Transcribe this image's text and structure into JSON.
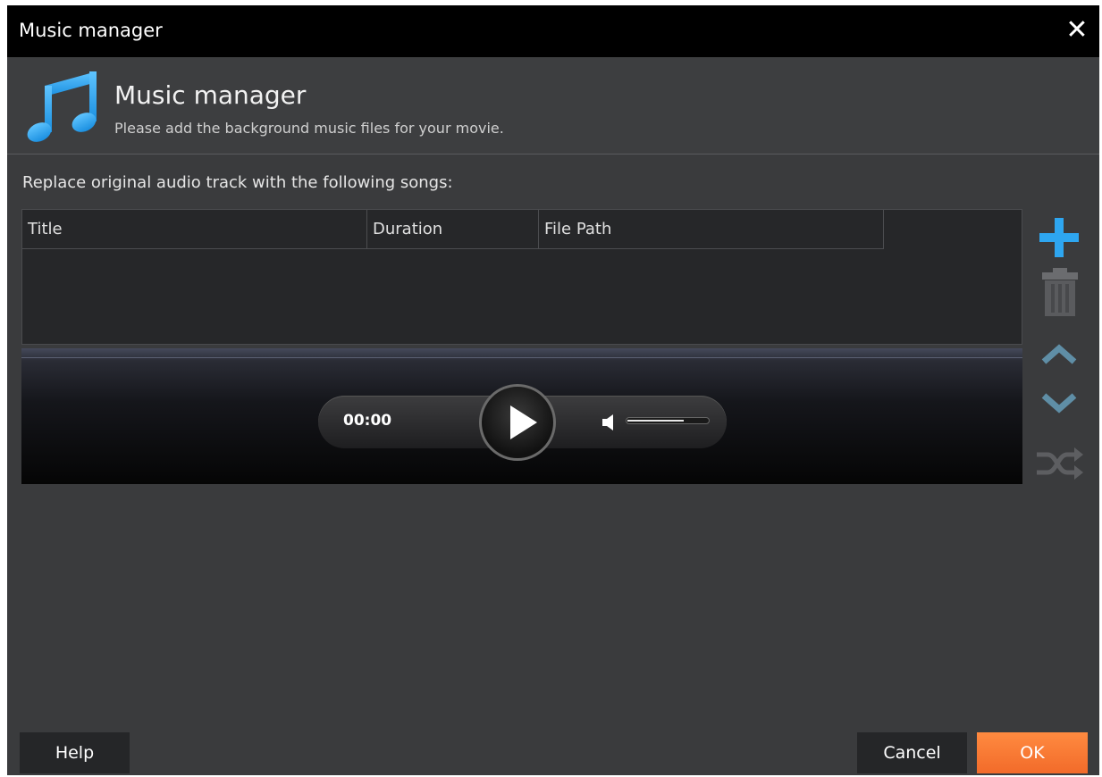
{
  "window": {
    "title": "Music manager",
    "close_glyph": "✕"
  },
  "header": {
    "title": "Music manager",
    "subtitle": "Please add the background music files for your movie.",
    "icon": "music-note-icon",
    "icon_color": "#2ea6f0"
  },
  "instruction": "Replace original audio track with the following songs:",
  "table": {
    "columns": [
      "Title",
      "Duration",
      "File Path"
    ],
    "rows": []
  },
  "player": {
    "time": "00:00",
    "volume_level": 0.7
  },
  "side_buttons": [
    "add-icon",
    "trash-icon",
    "chevron-up-icon",
    "chevron-down-icon",
    "shuffle-icon"
  ],
  "buttons": {
    "help": "Help",
    "cancel": "Cancel",
    "ok": "OK"
  },
  "colors": {
    "accent_blue": "#2ea6f0",
    "ok_orange": "#f47b35"
  }
}
